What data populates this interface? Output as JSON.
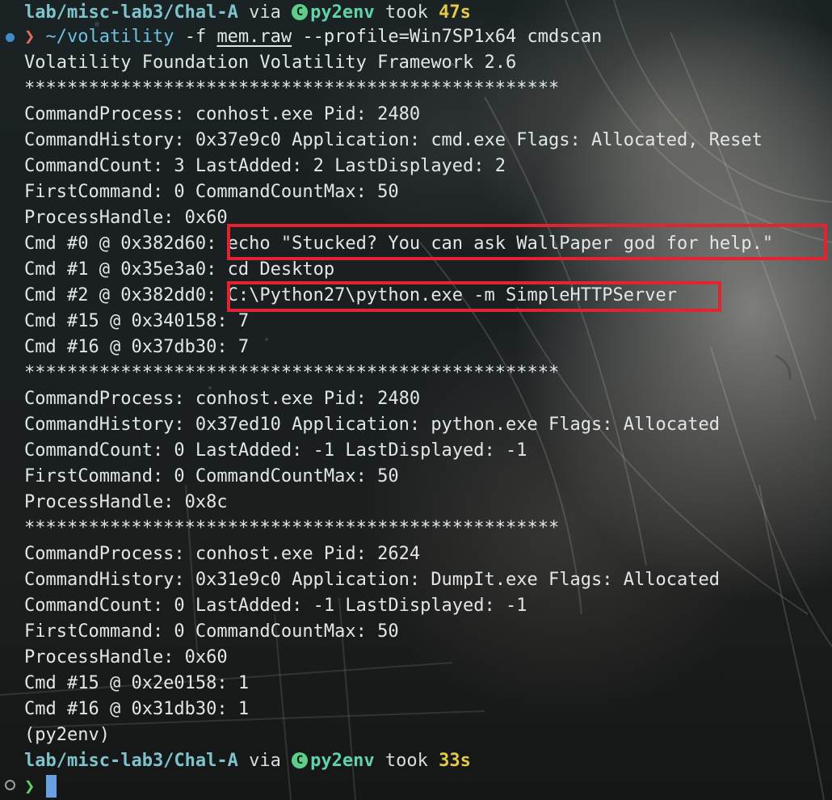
{
  "prompt_top": {
    "path": "lab/misc-lab3/Chal-A",
    "via": " via ",
    "env_icon": "python-badge-icon",
    "env_badge": "C",
    "env": "py2env",
    "took": " took ",
    "duration": "47s"
  },
  "command": {
    "arrow": "❯",
    "program": "~/volatility",
    "flag": " -f ",
    "file": "mem.raw",
    "rest": " --profile=Win7SP1x64 cmdscan"
  },
  "output": [
    "Volatility Foundation Volatility Framework 2.6",
    "**************************************************",
    "CommandProcess: conhost.exe Pid: 2480",
    "CommandHistory: 0x37e9c0 Application: cmd.exe Flags: Allocated, Reset",
    "CommandCount: 3 LastAdded: 2 LastDisplayed: 2",
    "FirstCommand: 0 CommandCountMax: 50",
    "ProcessHandle: 0x60",
    "Cmd #0 @ 0x382d60: echo \"Stucked? You can ask WallPaper god for help.\"",
    "Cmd #1 @ 0x35e3a0: cd Desktop",
    "Cmd #2 @ 0x382dd0: C:\\Python27\\python.exe -m SimpleHTTPServer",
    "Cmd #15 @ 0x340158: 7",
    "Cmd #16 @ 0x37db30: 7",
    "**************************************************",
    "CommandProcess: conhost.exe Pid: 2480",
    "CommandHistory: 0x37ed10 Application: python.exe Flags: Allocated",
    "CommandCount: 0 LastAdded: -1 LastDisplayed: -1",
    "FirstCommand: 0 CommandCountMax: 50",
    "ProcessHandle: 0x8c",
    "**************************************************",
    "CommandProcess: conhost.exe Pid: 2624",
    "CommandHistory: 0x31e9c0 Application: DumpIt.exe Flags: Allocated",
    "CommandCount: 0 LastAdded: -1 LastDisplayed: -1",
    "FirstCommand: 0 CommandCountMax: 50",
    "ProcessHandle: 0x60",
    "Cmd #15 @ 0x2e0158: 1",
    "Cmd #16 @ 0x31db30: 1",
    "(py2env)"
  ],
  "prompt_bottom": {
    "path": "lab/misc-lab3/Chal-A",
    "via": " via ",
    "env_icon": "python-badge-icon",
    "env_badge": "C",
    "env": "py2env",
    "took": " took ",
    "duration": "33s",
    "arrow": "❯"
  },
  "colors": {
    "path": "#7ec3cc",
    "env": "#62d2a9",
    "duration": "#e5c84a",
    "error_arrow": "#e2695b",
    "ok_arrow": "#60d065",
    "highlight_box": "#e3232d",
    "cursor": "#6a9fe0"
  }
}
